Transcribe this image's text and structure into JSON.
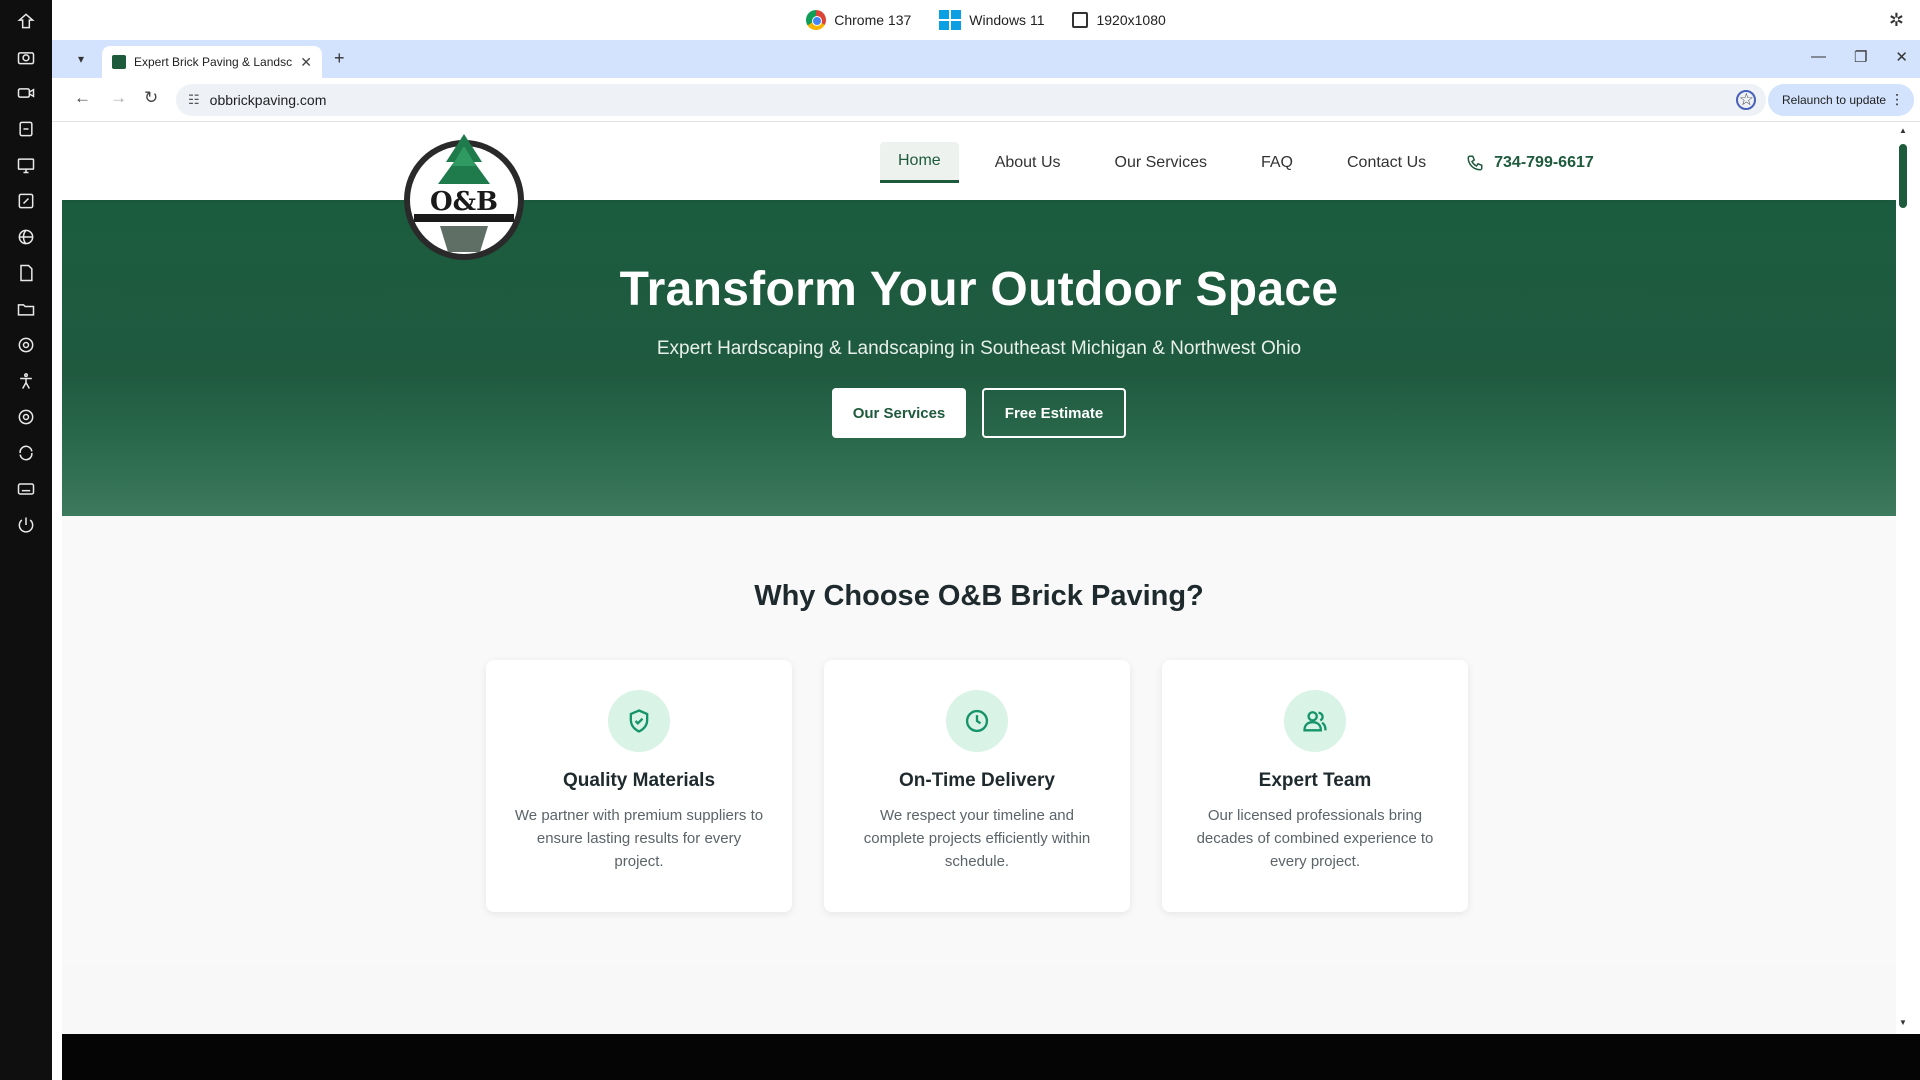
{
  "system_bar": {
    "browser": "Chrome 137",
    "os": "Windows 11",
    "resolution": "1920x1080"
  },
  "browser": {
    "tab_title": "Expert Brick Paving & Landscap",
    "url": "obbrickpaving.com",
    "relaunch_label": "Relaunch to update"
  },
  "site": {
    "logo_alt": "O&B Brick Paving & Landscaping Services LLC",
    "nav": [
      {
        "label": "Home",
        "active": true
      },
      {
        "label": "About Us"
      },
      {
        "label": "Our Services"
      },
      {
        "label": "FAQ"
      },
      {
        "label": "Contact Us"
      }
    ],
    "phone": "734-799-6617",
    "hero": {
      "title": "Transform Your Outdoor Space",
      "subtitle": "Expert Hardscaping & Landscaping in Southeast Michigan & Northwest Ohio",
      "primary_button": "Our Services",
      "secondary_button": "Free Estimate"
    },
    "why": {
      "title": "Why Choose O&B Brick Paving?",
      "cards": [
        {
          "icon": "shield-check-icon",
          "title": "Quality Materials",
          "desc": "We partner with premium suppliers to ensure lasting results for every project."
        },
        {
          "icon": "clock-icon",
          "title": "On-Time Delivery",
          "desc": "We respect your timeline and complete projects efficiently within schedule."
        },
        {
          "icon": "team-icon",
          "title": "Expert Team",
          "desc": "Our licensed professionals bring decades of combined experience to every project."
        }
      ]
    }
  },
  "colors": {
    "brand_green": "#1e5a3c",
    "icon_green": "#15946a",
    "icon_bg": "#d9f3e6"
  }
}
